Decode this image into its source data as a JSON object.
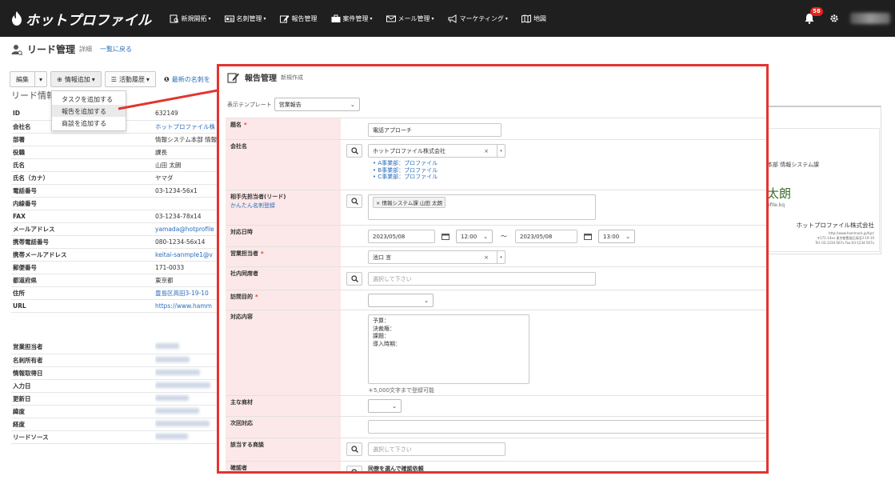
{
  "nav": {
    "brand": "ホットプロファイル",
    "items": [
      {
        "label": "新規開拓",
        "caret": true
      },
      {
        "label": "名刺管理",
        "caret": true
      },
      {
        "label": "報告管理",
        "caret": false
      },
      {
        "label": "案件管理",
        "caret": true
      },
      {
        "label": "メール管理",
        "caret": true
      },
      {
        "label": "マーケティング",
        "caret": true
      },
      {
        "label": "地図",
        "caret": false
      }
    ],
    "notification_count": "58"
  },
  "page": {
    "title": "リード管理",
    "subtitle": "詳細",
    "back_link": "一覧に戻る"
  },
  "toolbar": {
    "edit": "編集",
    "info_add": "情報追加",
    "activity_history": "活動履歴",
    "notice_bold": "❶",
    "notice_link": "最新の名刺を"
  },
  "dropdown": {
    "items": [
      "タスクを追加する",
      "報告を追加する",
      "商談を追加する"
    ],
    "active_index": 1
  },
  "section_title": "リード情報",
  "detail_rows": [
    {
      "key": "ID",
      "value": "632149",
      "link": false
    },
    {
      "key": "会社名",
      "value": "ホットプロファイル株",
      "link": true
    },
    {
      "key": "部署",
      "value": "情報システム本部 情報",
      "link": false
    },
    {
      "key": "役職",
      "value": "課長",
      "link": false
    },
    {
      "key": "氏名",
      "value": "山田 太朗",
      "link": false
    },
    {
      "key": "氏名（カナ）",
      "value": "ヤマダ",
      "link": false
    },
    {
      "key": "電話番号",
      "value": "03-1234-56x1",
      "link": false
    },
    {
      "key": "内線番号",
      "value": "",
      "link": false
    },
    {
      "key": "FAX",
      "value": "03-1234-78x14",
      "link": false
    },
    {
      "key": "メールアドレス",
      "value": "yamada@hotprofile",
      "link": true
    },
    {
      "key": "携帯電話番号",
      "value": "080-1234-56x14",
      "link": false
    },
    {
      "key": "携帯メールアドレス",
      "value": "keitai-sanmple1@v",
      "link": true
    },
    {
      "key": "郵便番号",
      "value": "171-0033",
      "link": false
    },
    {
      "key": "都道府県",
      "value": "東京都",
      "link": false
    },
    {
      "key": "住所",
      "value": "豊島区高田3-19-10",
      "link": true
    },
    {
      "key": "URL",
      "value": "https://www.hamm",
      "link": true
    }
  ],
  "detail_rows_2": [
    {
      "key": "営業担当者"
    },
    {
      "key": "名刺所有者"
    },
    {
      "key": "情報取得日"
    },
    {
      "key": "入力日"
    },
    {
      "key": "更新日"
    },
    {
      "key": "緯度"
    },
    {
      "key": "経度"
    },
    {
      "key": "リードソース"
    }
  ],
  "card": {
    "dept": "本部  情報システム課",
    "name": "太朗",
    "mail": "ofile.kq",
    "company": "ホットプロファイル株式会社",
    "url_small": "http://www.hammock.jp/hpr/",
    "addr_small": "〒171-14xx 東京都豊島区高田3-19-10",
    "tel_small": "Tel: 03-1234-567x  Fax:03-1234-567x"
  },
  "modal": {
    "title": "報告管理",
    "subtitle": "新規作成",
    "template_label": "表示テンプレート",
    "template_value": "営業報告",
    "fields": {
      "subject_label": "題名",
      "subject_value": "電話アプローチ",
      "company_label": "会社名",
      "company_value": "ホットプロファイル株式会社",
      "company_branches": [
        "A事業部：プロファイル",
        "B事業部：プロファイル",
        "C事業部：プロファイル"
      ],
      "contact_label": "相手先担当者(リード)",
      "contact_sublink": "かんたん名刺登録",
      "contact_tag": "情報システム課 山田 太朗",
      "datetime_label": "対応日時",
      "date_from": "2023/05/08",
      "time_from": "12:00",
      "range_sep": "〜",
      "date_to": "2023/05/08",
      "time_to": "13:00",
      "sales_label": "営業担当者",
      "sales_value": "池口 言",
      "colleague_label": "社内同席者",
      "colleague_placeholder": "選択して下さい",
      "purpose_label": "訪問目的",
      "content_label": "対応内容",
      "content_lines": [
        "予算：",
        "決裁権：",
        "課題：",
        "導入時期："
      ],
      "content_note": "＊5,000文字まで登録可能",
      "product_label": "主な商材",
      "next_label": "次回対応",
      "deal_label": "該当する商談",
      "deal_placeholder": "選択して下さい",
      "confirm_label": "確認者",
      "confirm_value": "同僚を選んで確認依頼"
    }
  },
  "colors": {
    "nav_bg": "#1f1f1f",
    "accent_red": "#e3342f",
    "link_blue": "#2a6ebb",
    "label_pink": "#fce8e8"
  }
}
